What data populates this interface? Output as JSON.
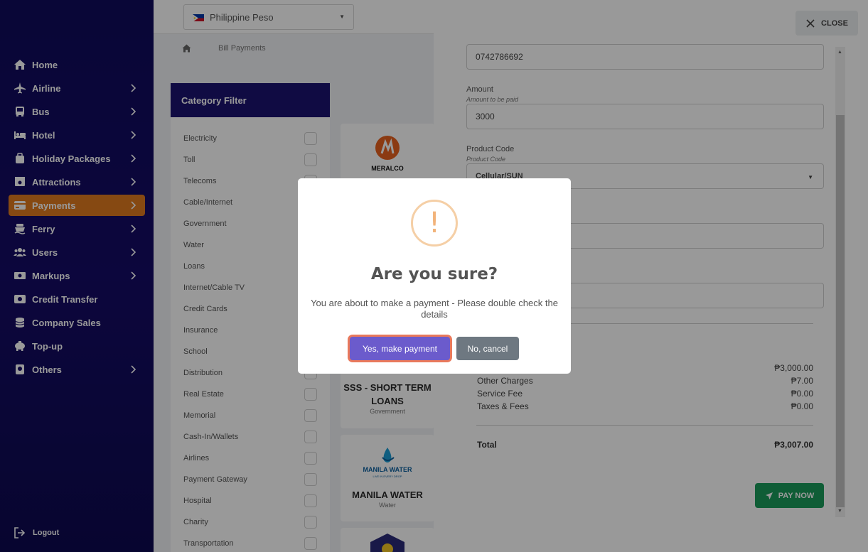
{
  "sidebar": {
    "items": [
      {
        "label": "Home",
        "icon": "home-icon",
        "chevron": false
      },
      {
        "label": "Airline",
        "icon": "airplane-icon",
        "chevron": true
      },
      {
        "label": "Bus",
        "icon": "bus-icon",
        "chevron": true
      },
      {
        "label": "Hotel",
        "icon": "bed-icon",
        "chevron": true
      },
      {
        "label": "Holiday Packages",
        "icon": "suitcase-icon",
        "chevron": true
      },
      {
        "label": "Attractions",
        "icon": "ticket-icon",
        "chevron": true
      },
      {
        "label": "Payments",
        "icon": "credit-card-icon",
        "chevron": true,
        "active": true
      },
      {
        "label": "Ferry",
        "icon": "ferry-icon",
        "chevron": true
      },
      {
        "label": "Users",
        "icon": "users-icon",
        "chevron": true
      },
      {
        "label": "Markups",
        "icon": "money-icon",
        "chevron": true
      },
      {
        "label": "Credit Transfer",
        "icon": "transfer-icon",
        "chevron": false
      },
      {
        "label": "Company Sales",
        "icon": "coins-icon",
        "chevron": false
      },
      {
        "label": "Top-up",
        "icon": "piggy-bank-icon",
        "chevron": false
      },
      {
        "label": "Others",
        "icon": "passport-icon",
        "chevron": true
      }
    ],
    "logout_label": "Logout",
    "active_color": "#e07a1f"
  },
  "topbar": {
    "currency": "Philippine Peso"
  },
  "breadcrumb": {
    "current": "Bill Payments"
  },
  "filter": {
    "title": "Category Filter",
    "categories": [
      "Electricity",
      "Toll",
      "Telecoms",
      "Cable/Internet",
      "Government",
      "Water",
      "Loans",
      "Internet/Cable TV",
      "Credit Cards",
      "Insurance",
      "School",
      "Distribution",
      "Real Estate",
      "Memorial",
      "Cash-In/Wallets",
      "Airlines",
      "Payment Gateway",
      "Hospital",
      "Charity",
      "Transportation"
    ]
  },
  "billers": [
    {
      "logo_text": "MERALCO"
    },
    {
      "name": "SSS - SHORT TERM LOANS",
      "category": "Government"
    },
    {
      "name": "MANILA WATER",
      "category": "Water",
      "logo_text": "MANILA WATER",
      "logo_sub": "LIVE IN EVERY DROP"
    }
  ],
  "payment_form": {
    "close_label": "CLOSE",
    "account_value": "0742786692",
    "amount_label": "Amount",
    "amount_hint": "Amount to be paid",
    "amount_value": "3000",
    "product_code_label": "Product Code",
    "product_code_hint": "Product Code",
    "product_code_value": "Cellular/SUN",
    "summary": [
      {
        "label": "",
        "value": "₱3,000.00"
      },
      {
        "label": "Other Charges",
        "value": "₱7.00"
      },
      {
        "label": "Service Fee",
        "value": "₱0.00"
      },
      {
        "label": "Taxes & Fees",
        "value": "₱0.00"
      }
    ],
    "total_label": "Total",
    "total_value": "₱3,007.00",
    "pay_label": "PAY NOW"
  },
  "dialog": {
    "icon_glyph": "!",
    "title": "Are you sure?",
    "message": "You are about to make a payment - Please double check the details",
    "confirm_label": "Yes, make payment",
    "cancel_label": "No, cancel",
    "confirm_color": "#6b5bcc",
    "cancel_color": "#6e7881"
  }
}
